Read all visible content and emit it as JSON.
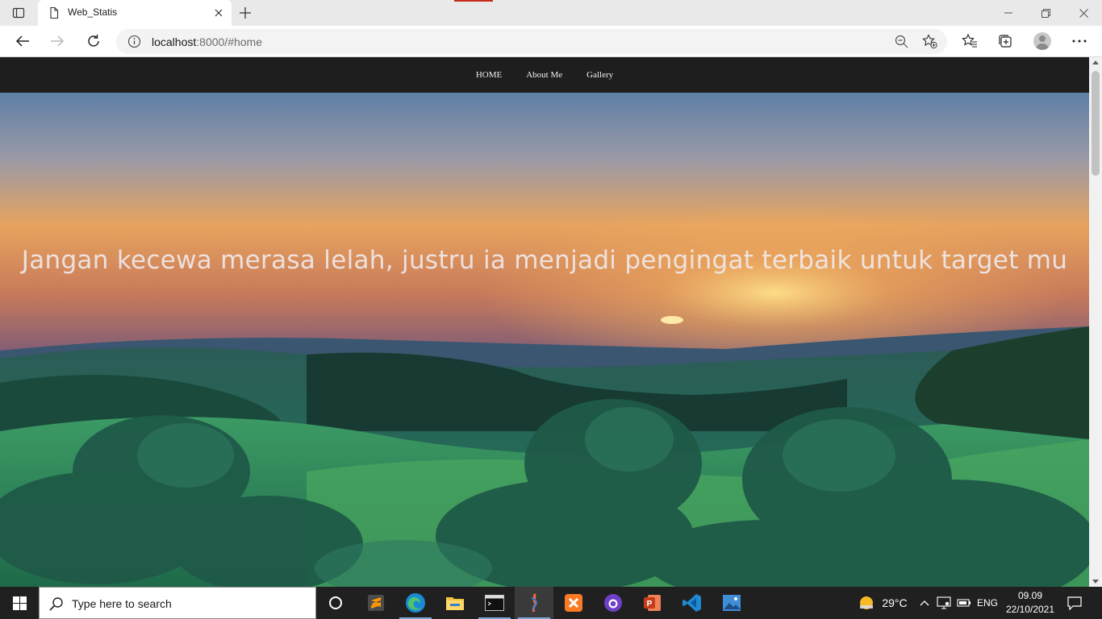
{
  "browser": {
    "tab_title": "Web_Statis",
    "url_host": "localhost",
    "url_path": ":8000/#home"
  },
  "site": {
    "nav": [
      {
        "label": "HOME"
      },
      {
        "label": "About Me"
      },
      {
        "label": "Gallery"
      }
    ],
    "hero_quote": "Jangan kecewa merasa lelah, justru ia menjadi pengingat terbaik untuk target mu"
  },
  "taskbar": {
    "search_placeholder": "Type here to search",
    "apps": [
      "cortana-icon",
      "sublime-text-icon",
      "edge-icon",
      "file-explorer-icon",
      "terminal-icon",
      "git-app-icon",
      "xampp-icon",
      "github-desktop-icon",
      "powerpoint-icon",
      "vscode-icon",
      "photos-icon"
    ],
    "weather": "29°C",
    "language": "ENG",
    "time": "09.09",
    "date": "22/10/2021"
  },
  "colors": {
    "site_nav_bg": "#1e1e1e",
    "taskbar_bg": "#202020",
    "tab_strip_bg": "#e9e9e9"
  }
}
